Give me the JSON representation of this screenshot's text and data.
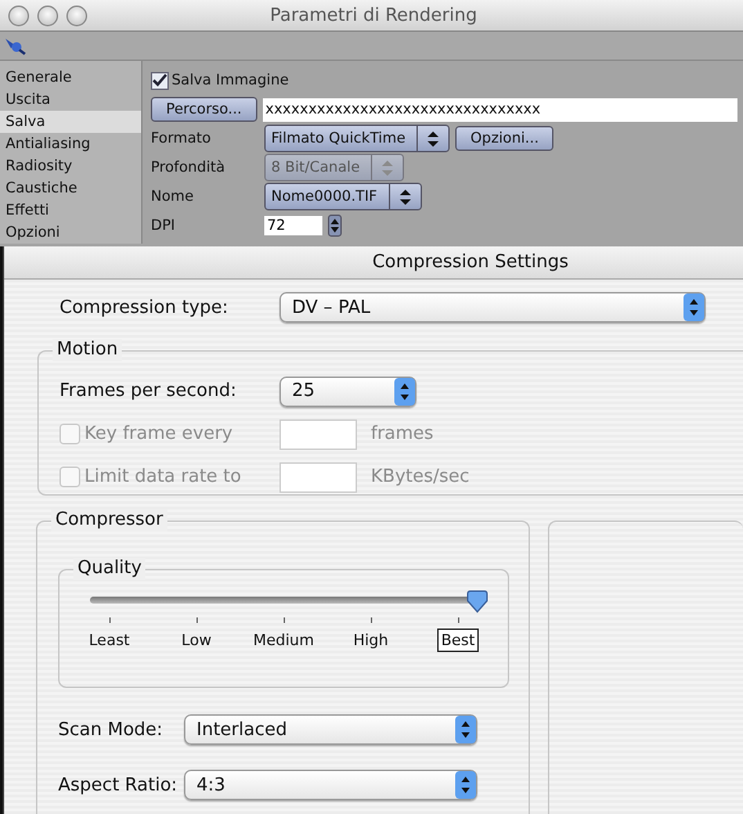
{
  "window": {
    "title": "Parametri di Rendering"
  },
  "sidebar": {
    "items": [
      {
        "label": "Generale",
        "selected": false
      },
      {
        "label": "Uscita",
        "selected": false
      },
      {
        "label": "Salva",
        "selected": true
      },
      {
        "label": "Antialiasing",
        "selected": false
      },
      {
        "label": "Radiosity",
        "selected": false
      },
      {
        "label": "Caustiche",
        "selected": false
      },
      {
        "label": "Effetti",
        "selected": false
      },
      {
        "label": "Opzioni",
        "selected": false
      }
    ]
  },
  "save_image": {
    "label": "Salva Immagine",
    "checked": true
  },
  "path": {
    "button": "Percorso...",
    "value": "xxxxxxxxxxxxxxxxxxxxxxxxxxxxxxxx"
  },
  "fields": [
    {
      "kind": "popup",
      "label": "Formato",
      "value": "Filmato QuickTime",
      "disabled": false,
      "button": "Opzioni..."
    },
    {
      "kind": "popup",
      "label": "Profondità",
      "value": "8 Bit/Canale",
      "disabled": true
    },
    {
      "kind": "popup",
      "label": "Nome",
      "value": "Nome0000.TIF",
      "disabled": false
    },
    {
      "kind": "stepper",
      "label": "DPI",
      "value": "72",
      "disabled": false
    }
  ],
  "dialog": {
    "title": "Compression Settings",
    "compression_type": {
      "label": "Compression type:",
      "value": "DV – PAL"
    },
    "motion": {
      "title": "Motion",
      "fps_label": "Frames per second:",
      "fps_value": "25",
      "options": [
        {
          "label": "Key frame every",
          "unit": "frames",
          "checked": false,
          "disabled": true
        },
        {
          "label": "Limit data rate to",
          "unit": "KBytes/sec",
          "checked": false,
          "disabled": true
        }
      ]
    },
    "compressor": {
      "title": "Compressor",
      "quality": {
        "title": "Quality",
        "level": 1,
        "ticks": [
          {
            "label": "Least",
            "selected": false
          },
          {
            "label": "Low",
            "selected": false
          },
          {
            "label": "Medium",
            "selected": false
          },
          {
            "label": "High",
            "selected": false
          },
          {
            "label": "Best",
            "selected": true
          }
        ]
      },
      "popups": [
        {
          "label": "Scan Mode:",
          "value": "Interlaced"
        },
        {
          "label": "Aspect Ratio:",
          "value": "4:3"
        }
      ]
    }
  }
}
